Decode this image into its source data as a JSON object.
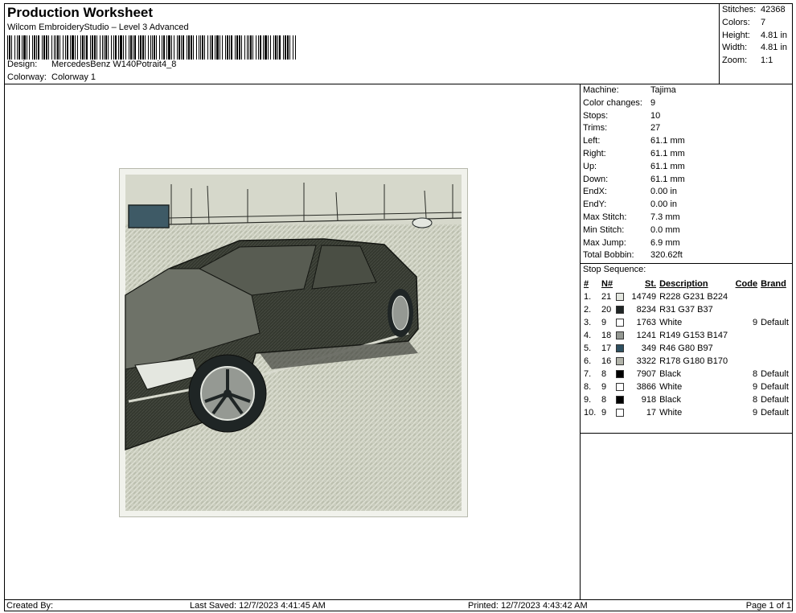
{
  "header": {
    "title": "Production Worksheet",
    "subtitle": "Wilcom EmbroideryStudio – Level 3 Advanced",
    "design_label": "Design:",
    "design_value": "MercedesBenz W140Potrait4_8",
    "colorway_label": "Colorway:",
    "colorway_value": "Colorway 1"
  },
  "stats": {
    "stitches_label": "Stitches:",
    "stitches": "42368",
    "colors_label": "Colors:",
    "colors": "7",
    "height_label": "Height:",
    "height": "4.81 in",
    "width_label": "Width:",
    "width": "4.81 in",
    "zoom_label": "Zoom:",
    "zoom": "1:1"
  },
  "machine_info": [
    {
      "label": "Machine:",
      "value": "Tajima"
    },
    {
      "label": "Color changes:",
      "value": "9"
    },
    {
      "label": "Stops:",
      "value": "10"
    },
    {
      "label": "Trims:",
      "value": "27"
    },
    {
      "label": "Left:",
      "value": "61.1 mm"
    },
    {
      "label": "Right:",
      "value": "61.1 mm"
    },
    {
      "label": "Up:",
      "value": "61.1 mm"
    },
    {
      "label": "Down:",
      "value": "61.1 mm"
    },
    {
      "label": "EndX:",
      "value": "0.00 in"
    },
    {
      "label": "EndY:",
      "value": "0.00 in"
    },
    {
      "label": "Max Stitch:",
      "value": "7.3 mm"
    },
    {
      "label": "Min Stitch:",
      "value": "0.0 mm"
    },
    {
      "label": "Max Jump:",
      "value": "6.9 mm"
    },
    {
      "label": "Total Bobbin:",
      "value": "320.62ft"
    }
  ],
  "stop_sequence": {
    "title": "Stop Sequence:",
    "headers": {
      "num": "#",
      "needle": "N#",
      "stitches": "St.",
      "description": "Description",
      "code": "Code",
      "brand": "Brand"
    },
    "rows": [
      {
        "num": "1.",
        "needle": "21",
        "color": "#E4E7E0",
        "stitches": "14749",
        "description": "R228 G231 B224",
        "code": "",
        "brand": ""
      },
      {
        "num": "2.",
        "needle": "20",
        "color": "#1F2525",
        "stitches": "8234",
        "description": "R31 G37 B37",
        "code": "",
        "brand": ""
      },
      {
        "num": "3.",
        "needle": "9",
        "color": "#FFFFFF",
        "stitches": "1763",
        "description": "White",
        "code": "9",
        "brand": "Default"
      },
      {
        "num": "4.",
        "needle": "18",
        "color": "#959993",
        "stitches": "1241",
        "description": "R149 G153 B147",
        "code": "",
        "brand": ""
      },
      {
        "num": "5.",
        "needle": "17",
        "color": "#2E5061",
        "stitches": "349",
        "description": "R46 G80 B97",
        "code": "",
        "brand": ""
      },
      {
        "num": "6.",
        "needle": "16",
        "color": "#B2B4AA",
        "stitches": "3322",
        "description": "R178 G180 B170",
        "code": "",
        "brand": ""
      },
      {
        "num": "7.",
        "needle": "8",
        "color": "#000000",
        "stitches": "7907",
        "description": "Black",
        "code": "8",
        "brand": "Default"
      },
      {
        "num": "8.",
        "needle": "9",
        "color": "#FFFFFF",
        "stitches": "3866",
        "description": "White",
        "code": "9",
        "brand": "Default"
      },
      {
        "num": "9.",
        "needle": "8",
        "color": "#000000",
        "stitches": "918",
        "description": "Black",
        "code": "8",
        "brand": "Default"
      },
      {
        "num": "10.",
        "needle": "9",
        "color": "#FFFFFF",
        "stitches": "17",
        "description": "White",
        "code": "9",
        "brand": "Default"
      }
    ]
  },
  "footer": {
    "created_by": "Created By:",
    "last_saved": "Last Saved: 12/7/2023 4:41:45 AM",
    "printed": "Printed: 12/7/2023 4:43:42 AM",
    "page": "Page 1 of 1"
  }
}
